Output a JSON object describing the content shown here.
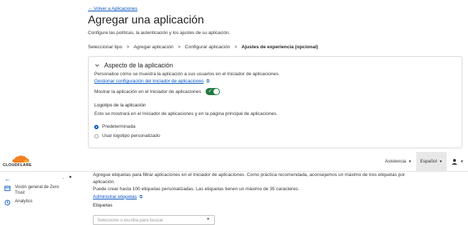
{
  "header": {
    "back_link": "← Volver a Aplicaciones",
    "title": "Agregar una aplicación",
    "subtitle": "Configure las políticas, la autenticación y los ajustes de su aplicación."
  },
  "steps": [
    "Seleccionar tipo",
    "Agregar aplicación",
    "Configurar aplicación",
    "Ajustes de experiencia (opcional)"
  ],
  "steps_separator": ">",
  "card": {
    "title": "Aspecto de la aplicación",
    "description": "Personalice cómo se muestra la aplicación a sus usuarios en el Iniciador de aplicaciones.",
    "manage_link": "Gestionar configuración del Iniciador de aplicaciones",
    "toggle_label": "Mostrar la aplicación en el Iniciador de aplicaciones",
    "toggle_on": true,
    "logo_heading": "Logotipo de la aplicación",
    "logo_description": "Esto se mostrará en el Iniciador de aplicaciones y en la página principal de aplicaciones.",
    "radio_options": [
      "Predeterminada",
      "Usar logotipo personalizado"
    ],
    "radio_selected": "Predeterminada"
  },
  "topbar": {
    "logo_text": "CLOUDFLARE",
    "support": "Asistencia",
    "language": "Español"
  },
  "sidebar": {
    "items": [
      {
        "label": "Visión general de Zero Trust",
        "icon": "grid-icon"
      },
      {
        "label": "Analytics",
        "icon": "clock-icon"
      }
    ]
  },
  "tags_section": {
    "description_1": "Agregue etiquetas para filtrar aplicaciones en el Iniciador de aplicaciones. Como práctica recomendada, aconsejamos un máximo de tres etiquetas por",
    "description_2": "aplicación.",
    "limit_text": "Puede crear hasta 100 etiquetas personalizadas. Las etiquetas tienen un máximo de 35 caracteres.",
    "manage_link": "Administrar etiquetas",
    "field_label": "Etiquetas",
    "placeholder": "Seleccione o escriba para buscar"
  },
  "colors": {
    "link": "#0051c3",
    "toggle_on": "#1f7a3d",
    "logo_orange": "#f38020"
  }
}
